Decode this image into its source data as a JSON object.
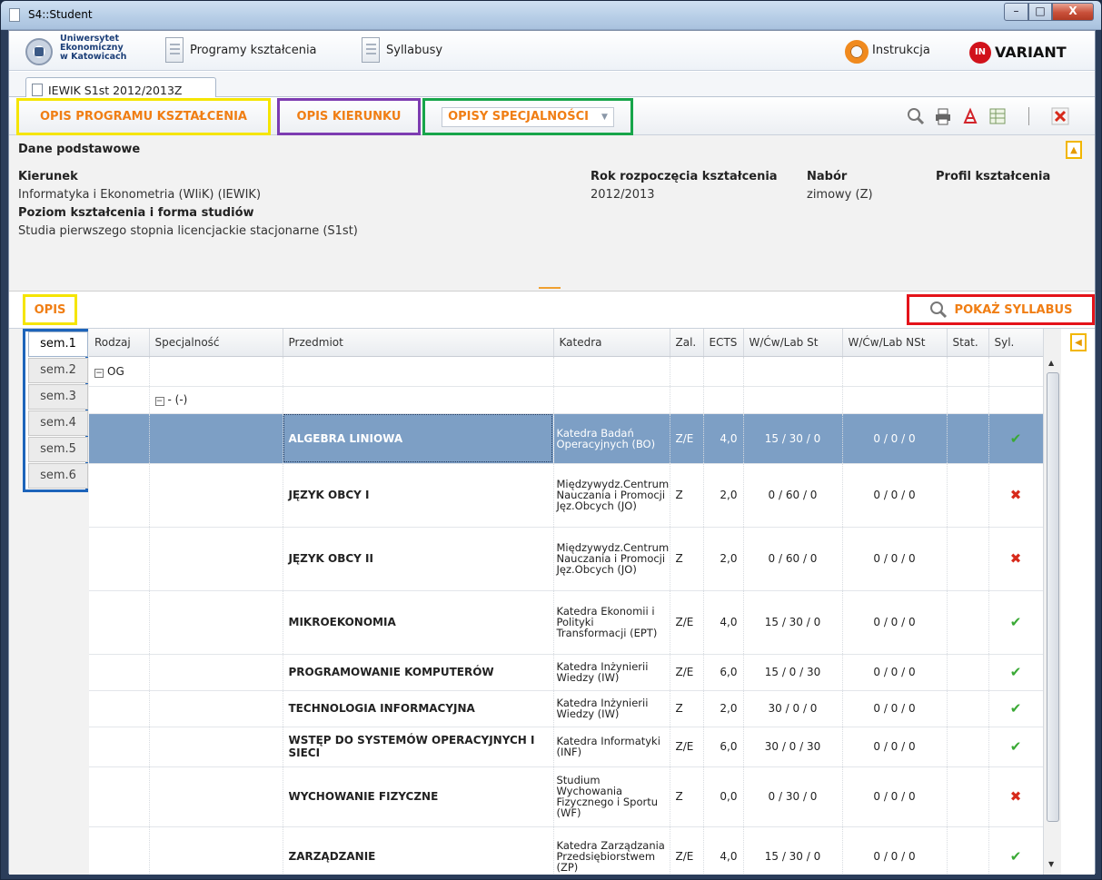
{
  "window": {
    "title": "S4::Student",
    "min": "–",
    "max": "□",
    "close": "X"
  },
  "topbar": {
    "uni_line1": "Uniwersytet",
    "uni_line2": "Ekonomiczny",
    "uni_line3": "w Katowicach",
    "programs": "Programy kształcenia",
    "syllabi": "Syllabusy",
    "help": "Instrukcja",
    "brand_mark": "IN",
    "brand": "VARIANT"
  },
  "tab": {
    "label": "IEWIK S1st 2012/2013Z"
  },
  "header": {
    "opis_programu": "OPIS PROGRAMU KSZTAŁCENIA",
    "opis_kierunku": "OPIS KIERUNKU",
    "opisy_specjalnosci": "OPISY SPECJALNOŚCI"
  },
  "dane": {
    "title": "Dane podstawowe",
    "kierunek_label": "Kierunek",
    "kierunek_value": "Informatyka i Ekonometria (WIiK) (IEWIK)",
    "poziom_label": "Poziom kształcenia i forma studiów",
    "poziom_value": "Studia pierwszego stopnia licencjackie stacjonarne (S1st)",
    "rok_label": "Rok rozpoczęcia kształcenia",
    "rok_value": "2012/2013",
    "nabor_label": "Nabór",
    "nabor_value": "zimowy (Z)",
    "profil_label": "Profil kształcenia"
  },
  "opis": {
    "label": "OPIS",
    "show_syllabus": "POKAŻ SYLLABUS"
  },
  "semesters": [
    "sem.1",
    "sem.2",
    "sem.3",
    "sem.4",
    "sem.5",
    "sem.6"
  ],
  "columns": [
    "Rodzaj",
    "Specjalność",
    "Przedmiot",
    "Katedra",
    "Zal.",
    "ECTS",
    "W/Ćw/Lab St",
    "W/Ćw/Lab NSt",
    "Stat.",
    "Syl."
  ],
  "group": {
    "rodzaj": "OG",
    "specjalnosc": "- (-)"
  },
  "rows": [
    {
      "przedmiot": "ALGEBRA LINIOWA",
      "katedra": "Katedra Badań Operacyjnych (BO)",
      "zal": "Z/E",
      "ects": "4,0",
      "st": "15 / 30 /  0",
      "nst": "0 /  0 /  0",
      "syl": "ok"
    },
    {
      "przedmiot": "JĘZYK OBCY I",
      "katedra": "Międzywydz.Centrum Nauczania i Promocji Jęz.Obcych (JO)",
      "zal": "Z",
      "ects": "2,0",
      "st": "0 / 60 /  0",
      "nst": "0 /  0 /  0",
      "syl": "no"
    },
    {
      "przedmiot": "JĘZYK OBCY II",
      "katedra": "Międzywydz.Centrum Nauczania i Promocji Jęz.Obcych (JO)",
      "zal": "Z",
      "ects": "2,0",
      "st": "0 / 60 /  0",
      "nst": "0 /  0 /  0",
      "syl": "no"
    },
    {
      "przedmiot": "MIKROEKONOMIA",
      "katedra": "Katedra Ekonomii i Polityki Transformacji (EPT)",
      "zal": "Z/E",
      "ects": "4,0",
      "st": "15 / 30 /  0",
      "nst": "0 /  0 /  0",
      "syl": "ok"
    },
    {
      "przedmiot": "PROGRAMOWANIE KOMPUTERÓW",
      "katedra": "Katedra Inżynierii Wiedzy (IW)",
      "zal": "Z/E",
      "ects": "6,0",
      "st": "15 /  0 / 30",
      "nst": "0 /  0 /  0",
      "syl": "ok"
    },
    {
      "przedmiot": "TECHNOLOGIA INFORMACYJNA",
      "katedra": "Katedra Inżynierii Wiedzy (IW)",
      "zal": "Z",
      "ects": "2,0",
      "st": "30 /  0 /  0",
      "nst": "0 /  0 /  0",
      "syl": "ok"
    },
    {
      "przedmiot": "WSTĘP DO SYSTEMÓW OPERACYJNYCH I SIECI",
      "katedra": "Katedra Informatyki (INF)",
      "zal": "Z/E",
      "ects": "6,0",
      "st": "30 /  0 / 30",
      "nst": "0 /  0 /  0",
      "syl": "ok"
    },
    {
      "przedmiot": "WYCHOWANIE FIZYCZNE",
      "katedra": "Studium Wychowania Fizycznego i Sportu (WF)",
      "zal": "Z",
      "ects": "0,0",
      "st": "0 / 30 /  0",
      "nst": "0 /  0 /  0",
      "syl": "no"
    },
    {
      "przedmiot": "ZARZĄDZANIE",
      "katedra": "Katedra Zarządzania Przedsiębiorstwem (ZP)",
      "zal": "Z/E",
      "ects": "4,0",
      "st": "15 / 30 /  0",
      "nst": "0 /  0 /  0",
      "syl": "ok"
    }
  ]
}
